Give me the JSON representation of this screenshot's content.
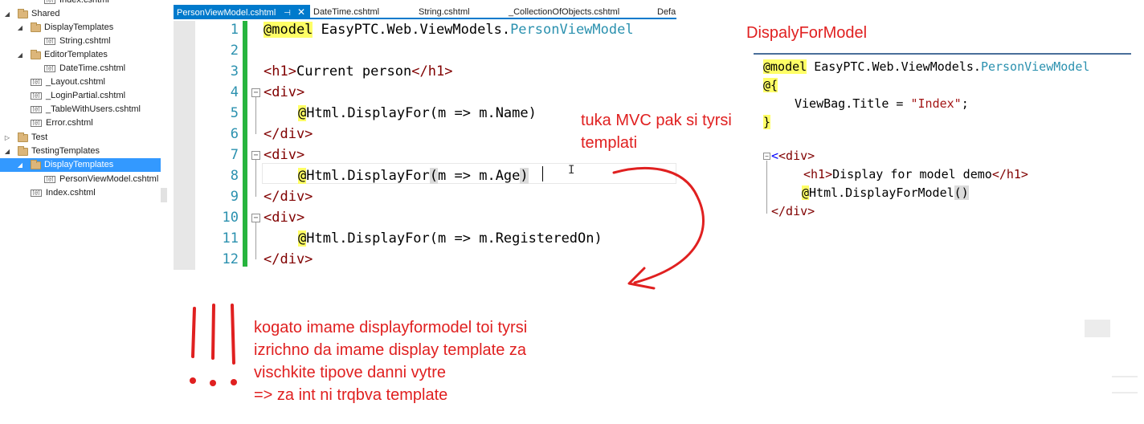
{
  "tree": {
    "items": [
      {
        "label": "Index.cshtml",
        "kind": "file",
        "arrow": ""
      },
      {
        "label": "Shared",
        "kind": "folder",
        "arrow": "◢"
      },
      {
        "label": "DisplayTemplates",
        "kind": "folder",
        "arrow": "◢"
      },
      {
        "label": "String.cshtml",
        "kind": "file",
        "arrow": ""
      },
      {
        "label": "EditorTemplates",
        "kind": "folder",
        "arrow": "◢"
      },
      {
        "label": "DateTime.cshtml",
        "kind": "file",
        "arrow": ""
      },
      {
        "label": "_Layout.cshtml",
        "kind": "file",
        "arrow": ""
      },
      {
        "label": "_LoginPartial.cshtml",
        "kind": "file",
        "arrow": ""
      },
      {
        "label": "_TableWithUsers.cshtml",
        "kind": "file",
        "arrow": ""
      },
      {
        "label": "Error.cshtml",
        "kind": "file",
        "arrow": ""
      },
      {
        "label": "Test",
        "kind": "folder",
        "arrow": "▷"
      },
      {
        "label": "TestingTemplates",
        "kind": "folder",
        "arrow": "◢"
      },
      {
        "label": "DisplayTemplates",
        "kind": "folder",
        "arrow": "◢",
        "selected": true
      },
      {
        "label": "PersonViewModel.cshtml",
        "kind": "file",
        "arrow": ""
      },
      {
        "label": "Index.cshtml",
        "kind": "file",
        "arrow": ""
      }
    ],
    "file_icon_text": "[@]"
  },
  "tabs": [
    {
      "label": "PersonViewModel.cshtml",
      "active": true,
      "pin": "⊣",
      "close": "✕"
    },
    {
      "label": "DateTime.cshtml"
    },
    {
      "label": "String.cshtml"
    },
    {
      "label": "_CollectionOfObjects.cshtml"
    },
    {
      "label": "Defa"
    }
  ],
  "editor": {
    "line_numbers": [
      "1",
      "2",
      "3",
      "4",
      "5",
      "6",
      "7",
      "8",
      "9",
      "10",
      "11",
      "12"
    ],
    "model_kw": "@model",
    "model_ns": " EasyPTC.Web.ViewModels.",
    "model_type": "PersonViewModel",
    "h1_open": "<h1>",
    "h1_text": "Current person",
    "h1_close": "</h1>",
    "div_open": "<div>",
    "div_close": "</div>",
    "at": "@",
    "call_name": "Html.DisplayFor",
    "lambda_prefix": "m => m.",
    "props": [
      "Name",
      "Age",
      "RegisteredOn"
    ],
    "fold_glyph": "−"
  },
  "right_panel": {
    "title": "DispalyForModel",
    "model_kw": "@model",
    "model_ns": " EasyPTC.Web.ViewModels.",
    "model_type": "PersonViewModel",
    "at_brace": "@{",
    "viewbag": "ViewBag.Title = ",
    "viewbag_value": "\"Index\"",
    "semicolon": ";",
    "close_brace": "}",
    "div_open": "<div>",
    "h1_open": "<h1>",
    "h1_text": "Display for model demo",
    "h1_close": "</h1>",
    "at": "@",
    "call": "Html.DisplayForModel",
    "call_parens": "()",
    "div_close": "</div>"
  },
  "annotations": {
    "note_top": [
      "tuka MVC pak si tyrsi",
      "templati"
    ],
    "note_bottom": [
      "kogato imame displayformodel toi tyrsi",
      "izrichno da imame display template za",
      "vischkite tipove danni vytre",
      "=> za int ni trqbva template"
    ]
  },
  "colors": {
    "annotation_red": "#e02020",
    "tab_active": "#007acc",
    "selection": "#3399ff",
    "change_bar": "#27b43e",
    "razor_highlight": "#ffff66"
  }
}
